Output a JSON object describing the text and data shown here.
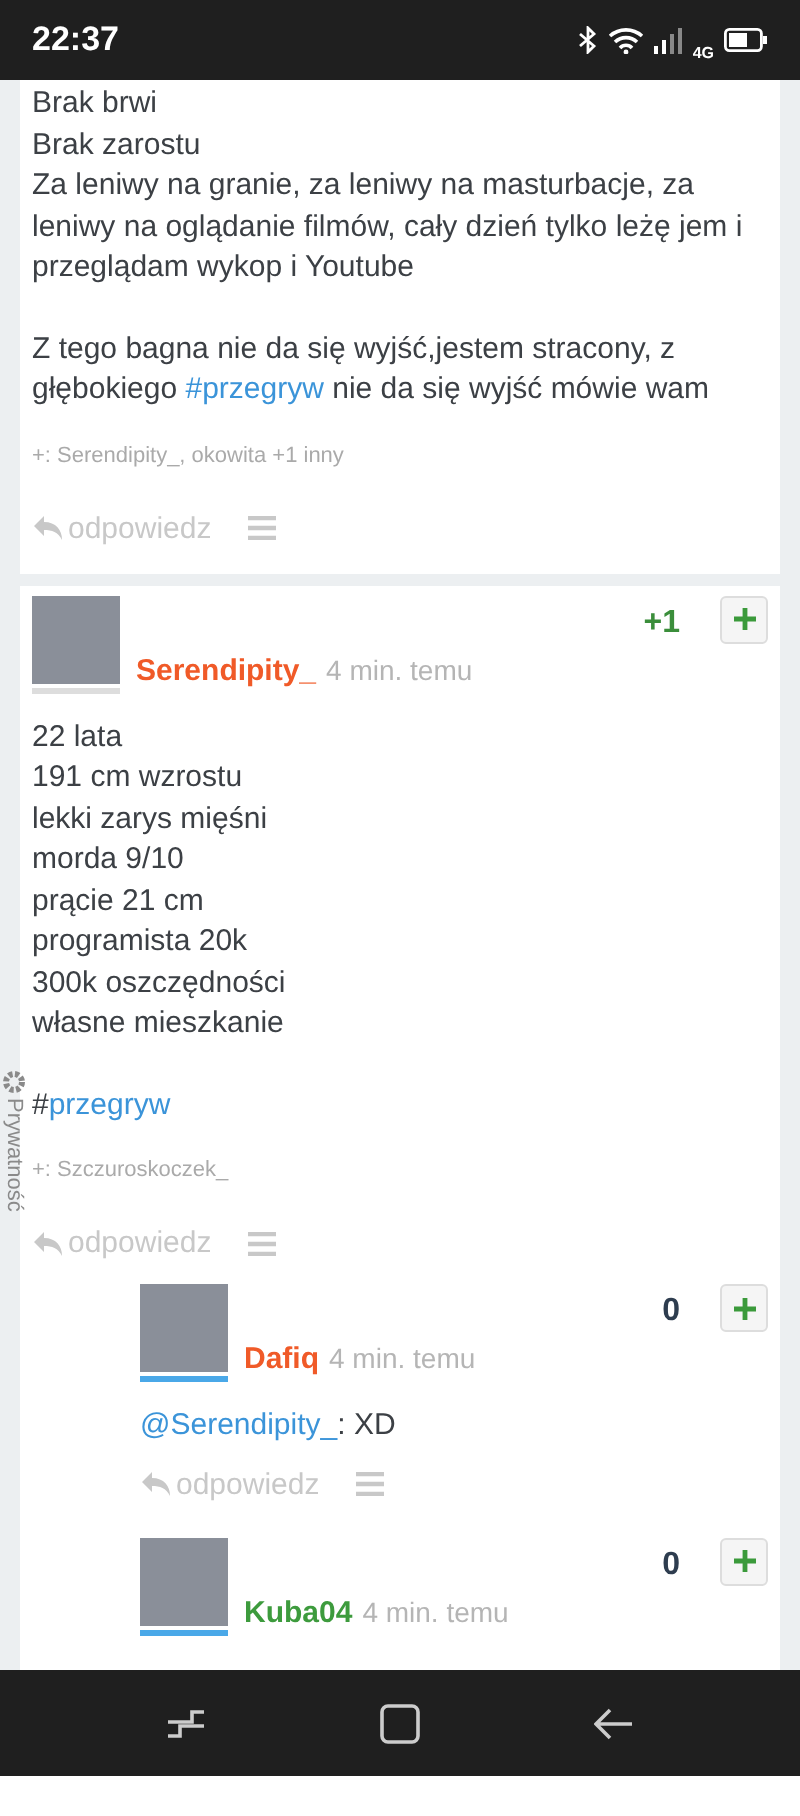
{
  "status_bar": {
    "time": "22:37",
    "network": "4G"
  },
  "posts": [
    {
      "paragraphs": [
        {
          "lines": [
            [
              {
                "kind": "text",
                "text": "Brak brwi"
              }
            ],
            [
              {
                "kind": "text",
                "text": "Brak zarostu"
              }
            ],
            [
              {
                "kind": "text",
                "text": "Za leniwy na granie, za leniwy na masturbacje, za leniwy na oglądanie filmów, cały dzień tylko leżę jem i przeglądam wykop i Youtube"
              }
            ]
          ]
        },
        {
          "lines": [
            [
              {
                "kind": "text",
                "text": "Z tego bagna nie da się wyjść,jestem stracony, z głębokiego "
              },
              {
                "kind": "tag",
                "text": "#przegryw"
              },
              {
                "kind": "text",
                "text": " nie da się wyjść mówie wam"
              }
            ]
          ]
        }
      ],
      "plussers": "+: Serendipity_, okowita +1 inny",
      "reply_label": "odpowiedz"
    },
    {
      "author": {
        "name": "Serendipity_",
        "color": "#f05a28",
        "time": "4 min. temu",
        "underline": {
          "color": "#dddddd"
        }
      },
      "score": "+1",
      "score_positive": true,
      "paragraphs": [
        {
          "lines": [
            [
              {
                "kind": "text",
                "text": "22 lata"
              }
            ],
            [
              {
                "kind": "text",
                "text": "191 cm wzrostu"
              }
            ],
            [
              {
                "kind": "text",
                "text": "lekki zarys mięśni"
              }
            ],
            [
              {
                "kind": "text",
                "text": "morda 9/10"
              }
            ],
            [
              {
                "kind": "text",
                "text": "prącie 21 cm"
              }
            ],
            [
              {
                "kind": "text",
                "text": "programista 20k"
              }
            ],
            [
              {
                "kind": "text",
                "text": "300k oszczędności"
              }
            ],
            [
              {
                "kind": "text",
                "text": "własne mieszkanie"
              }
            ]
          ]
        },
        {
          "lines": [
            [
              {
                "kind": "text",
                "text": "#"
              },
              {
                "kind": "tag",
                "text": "przegryw"
              }
            ]
          ]
        }
      ],
      "plussers": "+: Szczuroskoczek_",
      "reply_label": "odpowiedz",
      "replies": [
        {
          "author": {
            "name": "Dafiq",
            "color": "#f05a28",
            "time": "4 min. temu",
            "underline": {
              "color": "#4aa8e8"
            }
          },
          "score": "0",
          "score_positive": false,
          "lines": [
            [
              {
                "kind": "mention",
                "text": "@Serendipity_"
              },
              {
                "kind": "text",
                "text": ": XD"
              }
            ]
          ],
          "reply_label": "odpowiedz"
        },
        {
          "author": {
            "name": "Kuba04",
            "color": "#3d9b3d",
            "time": "4 min. temu",
            "underline": {
              "color": "#4aa8e8"
            }
          },
          "score": "0",
          "score_positive": false
        }
      ]
    }
  ],
  "privacy_tab": {
    "label": "Prywatność"
  }
}
